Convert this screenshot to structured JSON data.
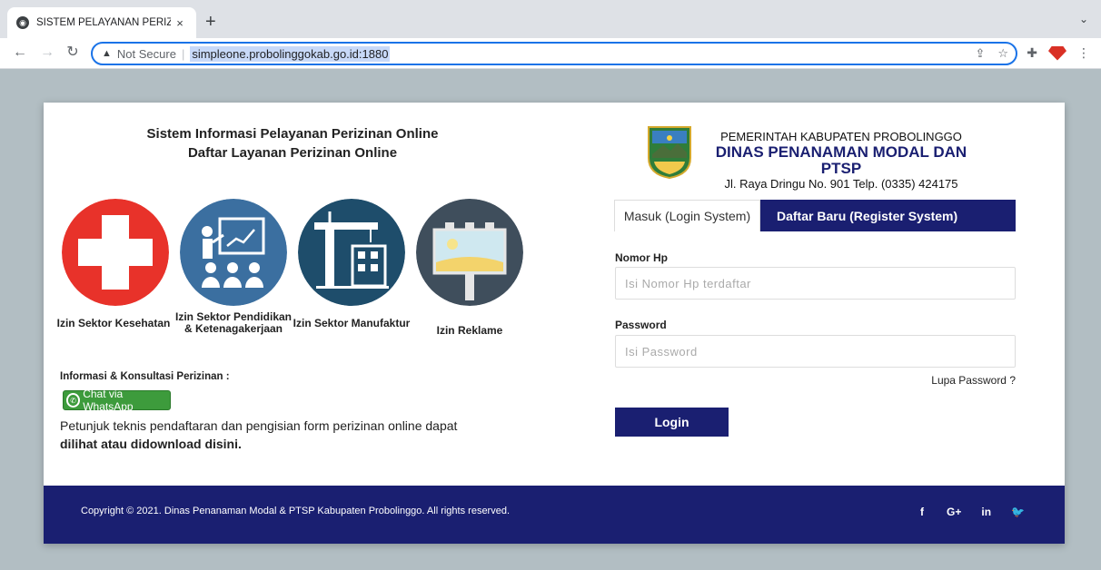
{
  "browser": {
    "tab_title": "SISTEM PELAYANAN PERIZINAN ONLINE",
    "tab_close": "×",
    "new_tab": "+",
    "tab_menu": "⌄",
    "security_label": "Not Secure",
    "url": "simpleone.probolinggokab.go.id:1880"
  },
  "page": {
    "left_title_line1": "Sistem Informasi Pelayanan Perizinan Online",
    "left_title_line2": "Daftar Layanan Perizinan Online",
    "services": [
      {
        "label": "Izin Sektor Kesehatan",
        "icon": "medical-cross-icon",
        "color": "#e8322a"
      },
      {
        "label": "Izin Sektor Pendidikan & Ketenagakerjaan",
        "icon": "teacher-presentation-icon",
        "color": "#3b6fa0"
      },
      {
        "label": "Izin Sektor Manufaktur",
        "icon": "construction-crane-icon",
        "color": "#1e4d6b"
      },
      {
        "label": "Izin Reklame",
        "icon": "billboard-icon",
        "color": "#3f4e5c"
      }
    ],
    "info_label": "Informasi & Konsultasi Perizinan :",
    "whatsapp_label": "Chat via WhatsApp",
    "petunjuk_text": "Petunjuk teknis pendaftaran dan pengisian form perizinan online dapat",
    "petunjuk_link": "dilihat atau didownload disini.",
    "org_line1": "PEMERINTAH KABUPATEN PROBOLINGGO",
    "org_line2": "DINAS PENANAMAN MODAL DAN PTSP",
    "org_line3": "Jl. Raya Dringu No. 901 Telp. (0335) 424175",
    "tab_login": "Masuk (Login System)",
    "tab_register": "Daftar Baru (Register System)",
    "nomor_label": "Nomor Hp",
    "nomor_placeholder": "Isi Nomor Hp terdaftar",
    "nomor_value": "",
    "password_label": "Password",
    "password_placeholder": "Isi Password",
    "password_value": "",
    "lupa_password": "Lupa Password ?",
    "login_button": "Login",
    "copyright": "Copyright © 2021. Dinas Penanaman Modal & PTSP Kabupaten Probolinggo. All rights reserved.",
    "social": [
      "f",
      "G+",
      "in",
      "🐦"
    ]
  },
  "colors": {
    "primary": "#1a1f71",
    "page_bg": "#b2bec3",
    "whatsapp": "#3d9b3c"
  }
}
